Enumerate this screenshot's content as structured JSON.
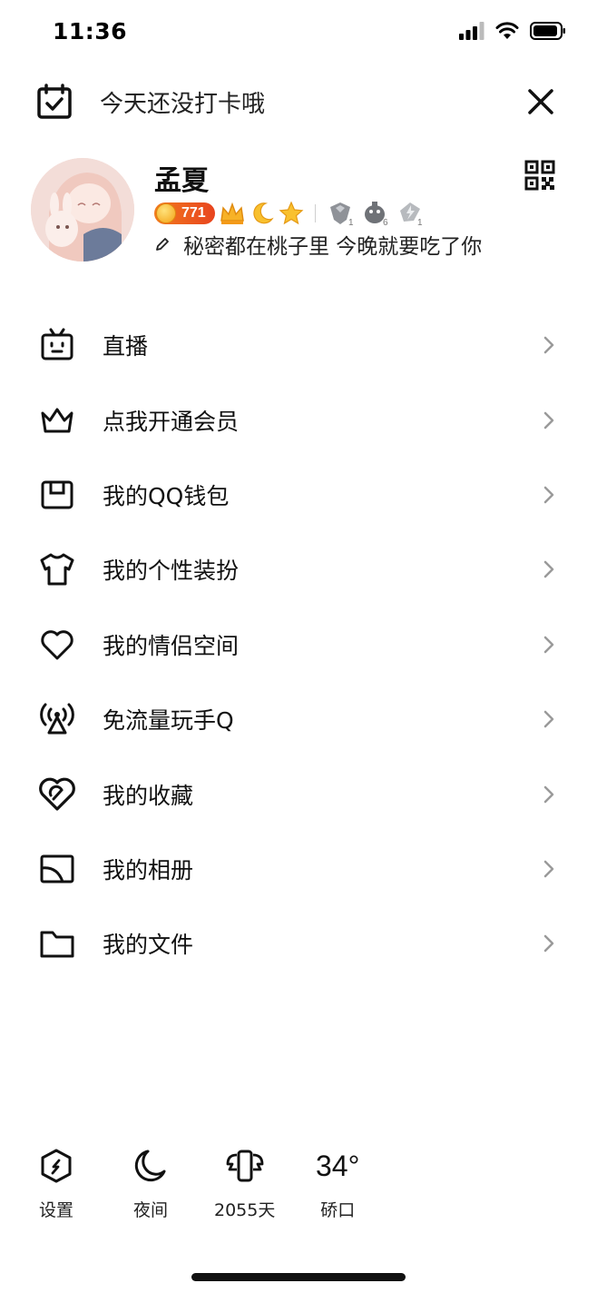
{
  "status_bar": {
    "time": "11:36"
  },
  "header": {
    "checkin_text": "今天还没打卡哦"
  },
  "profile": {
    "nickname": "孟夏",
    "level": "771",
    "signature": "秘密都在桃子里 今晚就要吃了你"
  },
  "menu": {
    "items": [
      {
        "label": "直播",
        "icon": "tv-icon"
      },
      {
        "label": "点我开通会员",
        "icon": "crown-icon"
      },
      {
        "label": "我的QQ钱包",
        "icon": "wallet-icon"
      },
      {
        "label": "我的个性装扮",
        "icon": "tshirt-icon"
      },
      {
        "label": "我的情侣空间",
        "icon": "heart-icon"
      },
      {
        "label": "免流量玩手Q",
        "icon": "signal-tower-icon"
      },
      {
        "label": "我的收藏",
        "icon": "favorite-heart-icon"
      },
      {
        "label": "我的相册",
        "icon": "album-icon"
      },
      {
        "label": "我的文件",
        "icon": "folder-icon"
      }
    ]
  },
  "bottom_bar": {
    "settings_label": "设置",
    "night_label": "夜间",
    "days_label": "2055天",
    "temperature": "34°",
    "location": "硚口"
  },
  "colors": {
    "level_pill": "#e8441e",
    "text": "#111111",
    "arrow": "#9a9a9a"
  }
}
